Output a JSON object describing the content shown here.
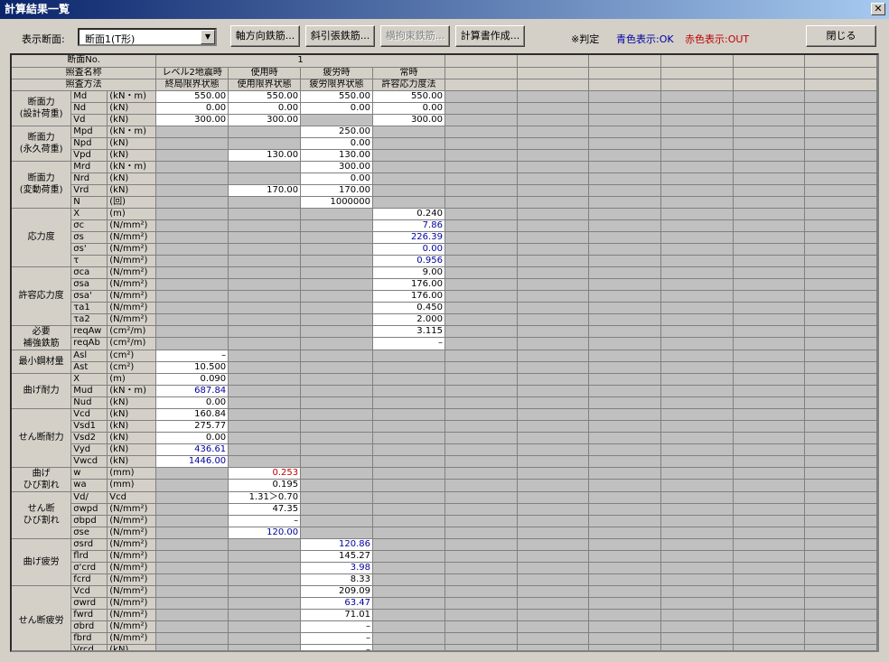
{
  "window": {
    "title": "計算結果一覧"
  },
  "toolbar": {
    "section_label": "表示断面:",
    "section_value": "断面1(T形)",
    "buttons": [
      "軸方向鉄筋...",
      "斜引張鉄筋...",
      "横拘束鉄筋...",
      "計算書作成..."
    ],
    "judge_label": "※判定",
    "ok_label": "青色表示:OK",
    "out_label": "赤色表示:OUT",
    "close_label": "閉じる"
  },
  "colors": {
    "ok": "#0000a0",
    "out": "#c00000"
  },
  "header": {
    "section_no_label": "断面No.",
    "section_no": "1",
    "case_label": "照査名称",
    "method_label": "照査方法",
    "cases": [
      "レベル2地震時",
      "使用時",
      "疲労時",
      "常時"
    ],
    "methods": [
      "終局限界状態",
      "使用限界状態",
      "疲労限界状態",
      "許容応力度法"
    ]
  },
  "groups": [
    {
      "label": "断面力\n(設計荷重)",
      "rows": [
        {
          "name": "Md",
          "unit": "(kN・m)",
          "v": [
            "550.00",
            "550.00",
            "550.00",
            "550.00"
          ]
        },
        {
          "name": "Nd",
          "unit": "(kN)",
          "v": [
            "0.00",
            "0.00",
            "0.00",
            "0.00"
          ]
        },
        {
          "name": "Vd",
          "unit": "(kN)",
          "v": [
            "300.00",
            "300.00",
            null,
            "300.00"
          ]
        }
      ]
    },
    {
      "label": "断面力\n(永久荷重)",
      "rows": [
        {
          "name": "Mpd",
          "unit": "(kN・m)",
          "v": [
            null,
            null,
            "250.00",
            null
          ]
        },
        {
          "name": "Npd",
          "unit": "(kN)",
          "v": [
            null,
            null,
            "0.00",
            null
          ]
        },
        {
          "name": "Vpd",
          "unit": "(kN)",
          "v": [
            null,
            "130.00",
            "130.00",
            null
          ]
        }
      ]
    },
    {
      "label": "断面力\n(変動荷重)",
      "rows": [
        {
          "name": "Mrd",
          "unit": "(kN・m)",
          "v": [
            null,
            null,
            "300.00",
            null
          ]
        },
        {
          "name": "Nrd",
          "unit": "(kN)",
          "v": [
            null,
            null,
            "0.00",
            null
          ]
        },
        {
          "name": "Vrd",
          "unit": "(kN)",
          "v": [
            null,
            "170.00",
            "170.00",
            null
          ]
        },
        {
          "name": "N",
          "unit": "(回)",
          "v": [
            null,
            null,
            "1000000",
            null
          ]
        }
      ]
    },
    {
      "label": "応力度",
      "rows": [
        {
          "name": "X",
          "unit": "(m)",
          "v": [
            null,
            null,
            null,
            "0.240"
          ]
        },
        {
          "name": "σc",
          "unit": "(N/mm²)",
          "v": [
            null,
            null,
            null,
            "7.86"
          ],
          "c": [
            null,
            null,
            null,
            "ok"
          ]
        },
        {
          "name": "σs",
          "unit": "(N/mm²)",
          "v": [
            null,
            null,
            null,
            "226.39"
          ],
          "c": [
            null,
            null,
            null,
            "ok"
          ]
        },
        {
          "name": "σs'",
          "unit": "(N/mm²)",
          "v": [
            null,
            null,
            null,
            "0.00"
          ],
          "c": [
            null,
            null,
            null,
            "ok"
          ]
        },
        {
          "name": "τ",
          "unit": "(N/mm²)",
          "v": [
            null,
            null,
            null,
            "0.956"
          ],
          "c": [
            null,
            null,
            null,
            "ok"
          ]
        }
      ]
    },
    {
      "label": "許容応力度",
      "rows": [
        {
          "name": "σca",
          "unit": "(N/mm²)",
          "v": [
            null,
            null,
            null,
            "9.00"
          ]
        },
        {
          "name": "σsa",
          "unit": "(N/mm²)",
          "v": [
            null,
            null,
            null,
            "176.00"
          ]
        },
        {
          "name": "σsa'",
          "unit": "(N/mm²)",
          "v": [
            null,
            null,
            null,
            "176.00"
          ]
        },
        {
          "name": "τa1",
          "unit": "(N/mm²)",
          "v": [
            null,
            null,
            null,
            "0.450"
          ]
        },
        {
          "name": "τa2",
          "unit": "(N/mm²)",
          "v": [
            null,
            null,
            null,
            "2.000"
          ]
        }
      ]
    },
    {
      "label": "必要\n補強鉄筋",
      "rows": [
        {
          "name": "reqAw",
          "unit": "(cm²/m)",
          "v": [
            null,
            null,
            null,
            "3.115"
          ]
        },
        {
          "name": "reqAb",
          "unit": "(cm²/m)",
          "v": [
            null,
            null,
            null,
            "–"
          ]
        }
      ]
    },
    {
      "label": "最小鋼材量",
      "rows": [
        {
          "name": "Asl",
          "unit": "(cm²)",
          "v": [
            "–",
            null,
            null,
            null
          ]
        },
        {
          "name": "Ast",
          "unit": "(cm²)",
          "v": [
            "10.500",
            null,
            null,
            null
          ]
        }
      ]
    },
    {
      "label": "曲げ耐力",
      "rows": [
        {
          "name": "X",
          "unit": "(m)",
          "v": [
            "0.090",
            null,
            null,
            null
          ]
        },
        {
          "name": "Mud",
          "unit": "(kN・m)",
          "v": [
            "687.84",
            null,
            null,
            null
          ],
          "c": [
            "ok",
            null,
            null,
            null
          ]
        },
        {
          "name": "Nud",
          "unit": "(kN)",
          "v": [
            "0.00",
            null,
            null,
            null
          ]
        }
      ]
    },
    {
      "label": "せん断耐力",
      "rows": [
        {
          "name": "Vcd",
          "unit": "(kN)",
          "v": [
            "160.84",
            null,
            null,
            null
          ]
        },
        {
          "name": "Vsd1",
          "unit": "(kN)",
          "v": [
            "275.77",
            null,
            null,
            null
          ]
        },
        {
          "name": "Vsd2",
          "unit": "(kN)",
          "v": [
            "0.00",
            null,
            null,
            null
          ]
        },
        {
          "name": "Vyd",
          "unit": "(kN)",
          "v": [
            "436.61",
            null,
            null,
            null
          ],
          "c": [
            "ok",
            null,
            null,
            null
          ]
        },
        {
          "name": "Vwcd",
          "unit": "(kN)",
          "v": [
            "1446.00",
            null,
            null,
            null
          ],
          "c": [
            "ok",
            null,
            null,
            null
          ]
        }
      ]
    },
    {
      "label": "曲げ\nひび割れ",
      "rows": [
        {
          "name": "w",
          "unit": "(mm)",
          "v": [
            null,
            "0.253",
            null,
            null
          ],
          "c": [
            null,
            "out",
            null,
            null
          ]
        },
        {
          "name": "wa",
          "unit": "(mm)",
          "v": [
            null,
            "0.195",
            null,
            null
          ]
        }
      ]
    },
    {
      "label": "せん断\nひび割れ",
      "rows": [
        {
          "name": "Vd/",
          "unit": "Vcd",
          "v": [
            null,
            "1.31＞0.70",
            null,
            null
          ]
        },
        {
          "name": "σwpd",
          "unit": "(N/mm²)",
          "v": [
            null,
            "47.35",
            null,
            null
          ]
        },
        {
          "name": "σbpd",
          "unit": "(N/mm²)",
          "v": [
            null,
            "–",
            null,
            null
          ]
        },
        {
          "name": "σse",
          "unit": "(N/mm²)",
          "v": [
            null,
            "120.00",
            null,
            null
          ],
          "c": [
            null,
            "ok",
            null,
            null
          ]
        }
      ]
    },
    {
      "label": "曲げ疲労",
      "rows": [
        {
          "name": "σsrd",
          "unit": "(N/mm²)",
          "v": [
            null,
            null,
            "120.86",
            null
          ],
          "c": [
            null,
            null,
            "ok",
            null
          ]
        },
        {
          "name": "flrd",
          "unit": "(N/mm²)",
          "v": [
            null,
            null,
            "145.27",
            null
          ]
        },
        {
          "name": "σ'crd",
          "unit": "(N/mm²)",
          "v": [
            null,
            null,
            "3.98",
            null
          ],
          "c": [
            null,
            null,
            "ok",
            null
          ]
        },
        {
          "name": "fcrd",
          "unit": "(N/mm²)",
          "v": [
            null,
            null,
            "8.33",
            null
          ]
        }
      ]
    },
    {
      "label": "せん断疲労",
      "rows": [
        {
          "name": "Vcd",
          "unit": "(N/mm²)",
          "v": [
            null,
            null,
            "209.09",
            null
          ]
        },
        {
          "name": "σwrd",
          "unit": "(N/mm²)",
          "v": [
            null,
            null,
            "63.47",
            null
          ],
          "c": [
            null,
            null,
            "ok",
            null
          ]
        },
        {
          "name": "fwrd",
          "unit": "(N/mm²)",
          "v": [
            null,
            null,
            "71.01",
            null
          ]
        },
        {
          "name": "σbrd",
          "unit": "(N/mm²)",
          "v": [
            null,
            null,
            "–",
            null
          ]
        },
        {
          "name": "fbrd",
          "unit": "(N/mm²)",
          "v": [
            null,
            null,
            "–",
            null
          ]
        },
        {
          "name": "Vrcd",
          "unit": "(kN)",
          "v": [
            null,
            null,
            "–",
            null
          ]
        }
      ]
    }
  ]
}
